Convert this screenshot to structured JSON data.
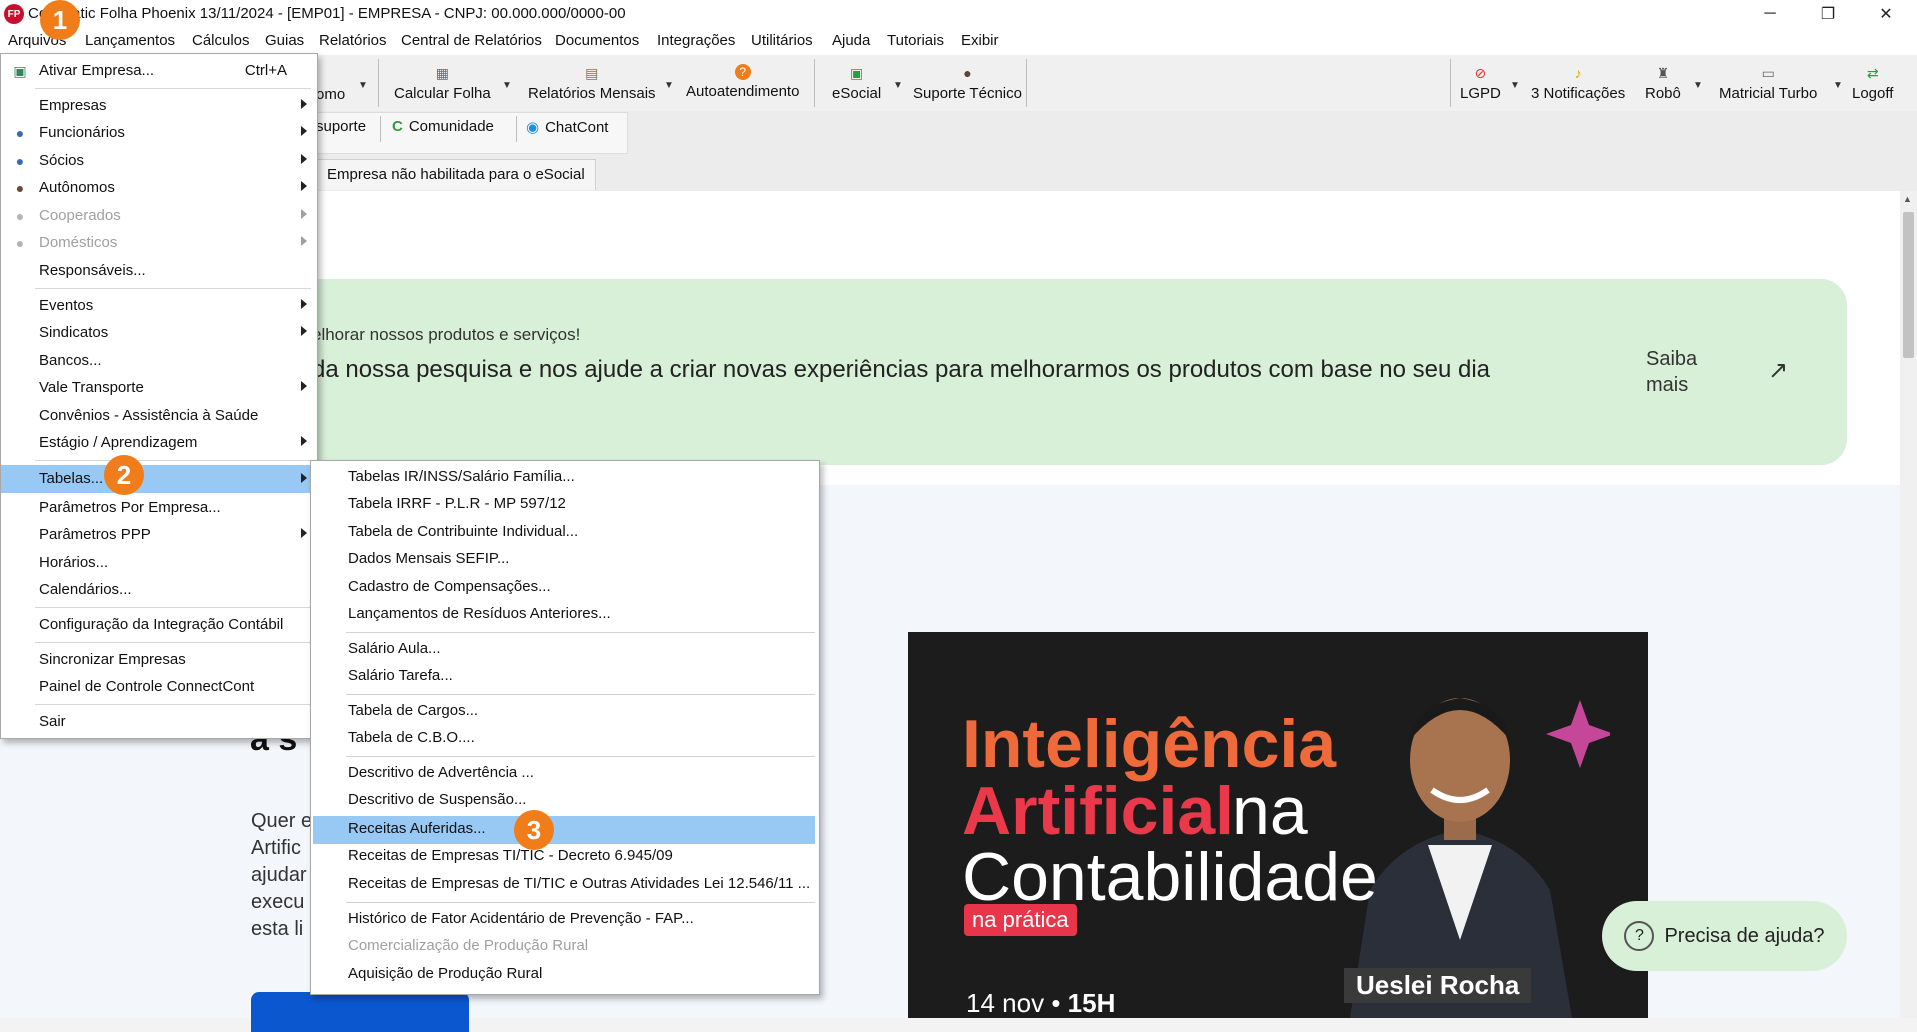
{
  "window": {
    "title": "Contmatic Folha Phoenix 13/11/2024 - [EMP01] - EMPRESA - CNPJ: 00.000.000/0000-00",
    "minimize": "─",
    "restore": "❐",
    "close": "✕"
  },
  "menubar": [
    "Arquivos",
    "Lançamentos",
    "Cálculos",
    "Guias",
    "Relatórios",
    "Central de Relatórios",
    "Documentos",
    "Integrações",
    "Utilitários",
    "Ajuda",
    "Tutoriais",
    "Exibir"
  ],
  "toolbar": {
    "partial_label": "omo",
    "buttons": [
      "Calcular Folha",
      "Relatórios Mensais",
      "Autoatendimento",
      "eSocial",
      "Suporte Técnico",
      "LGPD",
      "3 Notificações",
      "Robô",
      "Matricial Turbo",
      "Logoff"
    ],
    "row2": {
      "suporte": "suporte",
      "comunidade": "Comunidade",
      "chatcont": "ChatCont"
    },
    "tab": "Empresa não habilitada para o eSocial"
  },
  "banner": {
    "subtitle": "elhorar nossos produtos e serviços!",
    "main": "da nossa pesquisa e nos ajude a criar novas experiências para melhorarmos os produtos com base no seu dia",
    "link": "Saiba mais",
    "arrow": "↗"
  },
  "left_text": {
    "heading": "a s",
    "lines": [
      "Quer e",
      "Artific",
      "ajudar",
      "execu",
      "esta li"
    ]
  },
  "promo": {
    "line1": "Inteligência",
    "line2a": "Artificial",
    "line2b": "na",
    "line3": "Contabilidade",
    "tag": "na prática",
    "date": "14 nov",
    "time": "15H",
    "date_sep": "•",
    "speaker": "Ueslei Rocha"
  },
  "help": {
    "label": "Precisa de ajuda?",
    "icon": "?"
  },
  "menu_arquivos": {
    "items": [
      {
        "label": "Ativar Empresa...",
        "shortcut": "Ctrl+A"
      },
      {
        "label": "Empresas"
      },
      {
        "label": "Funcionários"
      },
      {
        "label": "Sócios"
      },
      {
        "label": "Autônomos"
      },
      {
        "label": "Cooperados"
      },
      {
        "label": "Domésticos"
      },
      {
        "label": "Responsáveis..."
      },
      {
        "label": "Eventos"
      },
      {
        "label": "Sindicatos"
      },
      {
        "label": "Bancos..."
      },
      {
        "label": "Vale Transporte"
      },
      {
        "label": "Convênios - Assistência à Saúde"
      },
      {
        "label": "Estágio / Aprendizagem"
      },
      {
        "label": "Tabelas..."
      },
      {
        "label": "Parâmetros Por Empresa..."
      },
      {
        "label": "Parâmetros PPP"
      },
      {
        "label": "Horários..."
      },
      {
        "label": "Calendários..."
      },
      {
        "label": "Configuração da Integração Contábil"
      },
      {
        "label": "Sincronizar Empresas"
      },
      {
        "label": "Painel de Controle ConnectCont"
      },
      {
        "label": "Sair"
      }
    ]
  },
  "menu_tabelas": {
    "items": [
      "Tabelas IR/INSS/Salário Família...",
      "Tabela IRRF - P.L.R - MP 597/12",
      "Tabela de Contribuinte Individual...",
      "Dados Mensais SEFIP...",
      "Cadastro de Compensações...",
      "Lançamentos de Resíduos Anteriores...",
      "Salário Aula...",
      "Salário Tarefa...",
      "Tabela de Cargos...",
      "Tabela de C.B.O....",
      "Descritivo de Advertência ...",
      "Descritivo de Suspensão...",
      "Receitas Auferidas...",
      "Receitas de Empresas TI/TIC - Decreto 6.945/09",
      "Receitas de Empresas de TI/TIC e Outras Atividades Lei 12.546/11 ...",
      "Histórico de Fator Acidentário de Prevenção - FAP...",
      "Comercialização de Produção Rural",
      "Aquisição de Produção Rural"
    ]
  },
  "badges": [
    "1",
    "2",
    "3"
  ],
  "colors": {
    "highlight": "#98c8f4",
    "badge": "#f07d1a",
    "banner": "#d8efd8",
    "promo_orange": "#ef6a3a",
    "promo_red": "#e9394a"
  }
}
